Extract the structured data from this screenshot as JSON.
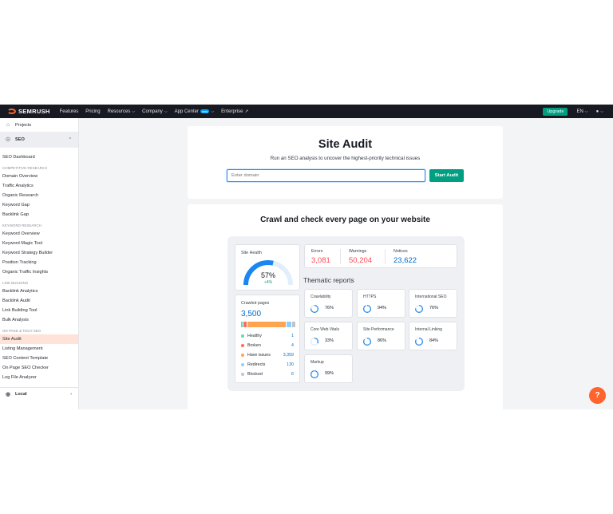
{
  "nav": {
    "logo": "SEMRUSH",
    "items": [
      {
        "label": "Features",
        "dropdown": false
      },
      {
        "label": "Pricing",
        "dropdown": false
      },
      {
        "label": "Resources",
        "dropdown": true
      },
      {
        "label": "Company",
        "dropdown": true
      },
      {
        "label": "App Center",
        "dropdown": true,
        "badge": "new"
      },
      {
        "label": "Enterprise",
        "external": true
      }
    ],
    "upgrade_label": "Upgrade",
    "lang": "EN"
  },
  "sidebar": {
    "projects": "Projects",
    "seo": "SEO",
    "dashboard": "SEO Dashboard",
    "groups": [
      {
        "title": "COMPETITIVE RESEARCH",
        "items": [
          "Domain Overview",
          "Traffic Analytics",
          "Organic Research",
          "Keyword Gap",
          "Backlink Gap"
        ]
      },
      {
        "title": "KEYWORD RESEARCH",
        "items": [
          "Keyword Overview",
          "Keyword Magic Tool",
          "Keyword Strategy Builder",
          "Position Tracking",
          "Organic Traffic Insights"
        ]
      },
      {
        "title": "LINK BUILDING",
        "items": [
          "Backlink Analytics",
          "Backlink Audit",
          "Link Building Tool",
          "Bulk Analysis"
        ]
      },
      {
        "title": "ON PAGE & TECH SEO",
        "items": [
          "Site Audit",
          "Listing Management",
          "SEO Content Template",
          "On Page SEO Checker",
          "Log File Analyzer"
        ]
      }
    ],
    "active_item": "Site Audit",
    "local": "Local"
  },
  "hero": {
    "title": "Site Audit",
    "subtitle": "Run an SEO analysis to uncover the highest-priority technical issues",
    "input_placeholder": "Enter domain",
    "button": "Start Audit"
  },
  "crawl": {
    "title": "Crawl and check every page on your website",
    "site_health": {
      "label": "Site Health",
      "value": "57%",
      "fraction": 0.57,
      "delta": "+4%"
    },
    "stats": [
      {
        "label": "Errors",
        "value": "3,081",
        "color": "#ff4953"
      },
      {
        "label": "Warnings",
        "value": "50,204",
        "color": "#ff4953"
      },
      {
        "label": "Notices",
        "value": "23,622",
        "color": "#006dca"
      }
    ],
    "crawled": {
      "label": "Crawled pages",
      "value": "3,500",
      "legend": [
        {
          "label": "Healthy",
          "value": "1",
          "color": "#59ddaa"
        },
        {
          "label": "Broken",
          "value": "4",
          "color": "#ff6b5b"
        },
        {
          "label": "Have issues",
          "value": "3,359",
          "color": "#ffa552"
        },
        {
          "label": "Redirects",
          "value": "130",
          "color": "#8fcdff"
        },
        {
          "label": "Blocked",
          "value": "6",
          "color": "#c2c4ca"
        }
      ]
    },
    "thematic_title": "Thematic reports",
    "reports": [
      {
        "name": "Crawlability",
        "value": "76%",
        "fraction": 0.76
      },
      {
        "name": "HTTPS",
        "value": "94%",
        "fraction": 0.94
      },
      {
        "name": "International SEO",
        "value": "76%",
        "fraction": 0.76
      },
      {
        "name": "Core Web Vitals",
        "value": "33%",
        "fraction": 0.33
      },
      {
        "name": "Site Performance",
        "value": "86%",
        "fraction": 0.86
      },
      {
        "name": "Internal Linking",
        "value": "84%",
        "fraction": 0.84
      },
      {
        "name": "Markup",
        "value": "99%",
        "fraction": 0.99
      }
    ]
  },
  "help": "?"
}
